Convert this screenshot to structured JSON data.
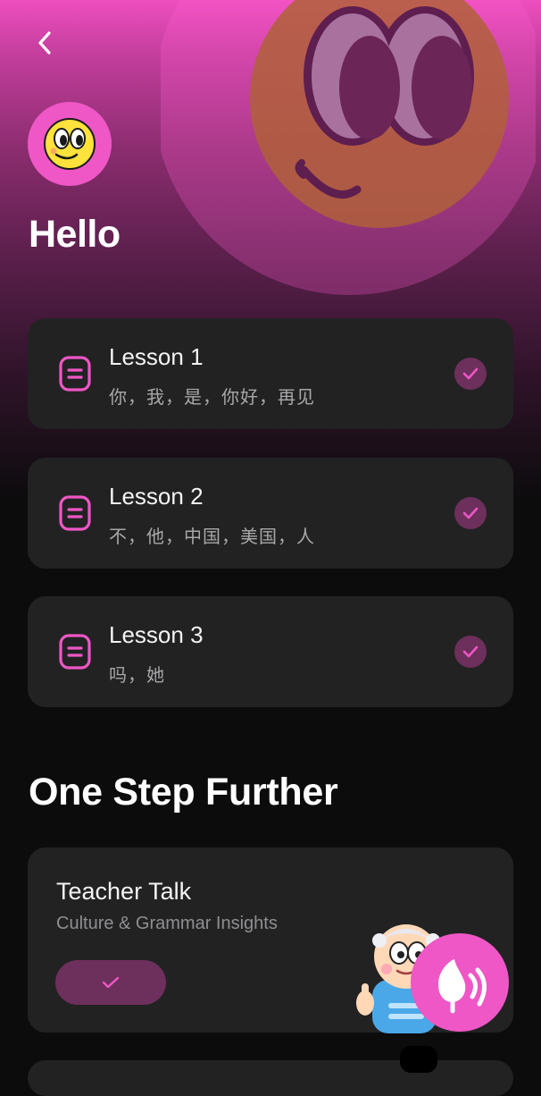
{
  "header": {
    "title": "Hello"
  },
  "lessons": [
    {
      "title": "Lesson 1",
      "words": "你，我，是，你好，再见",
      "completed": true
    },
    {
      "title": "Lesson 2",
      "words": "不，他，中国，美国，人",
      "completed": true
    },
    {
      "title": "Lesson 3",
      "words": "吗，她",
      "completed": true
    }
  ],
  "section": {
    "title": "One Step Further"
  },
  "teacher_talk": {
    "title": "Teacher Talk",
    "subtitle": "Culture & Grammar Insights",
    "completed": true
  },
  "icons": {
    "back": "chevron-left-icon",
    "avatar": "smiley-face-icon",
    "lesson": "document-icon",
    "check": "check-icon",
    "fab": "app-logo-icon"
  },
  "colors": {
    "accent": "#ee57c5",
    "check_bg": "#6d2f5c",
    "card_bg": "#222223",
    "page_bg": "#0c0c0d"
  }
}
